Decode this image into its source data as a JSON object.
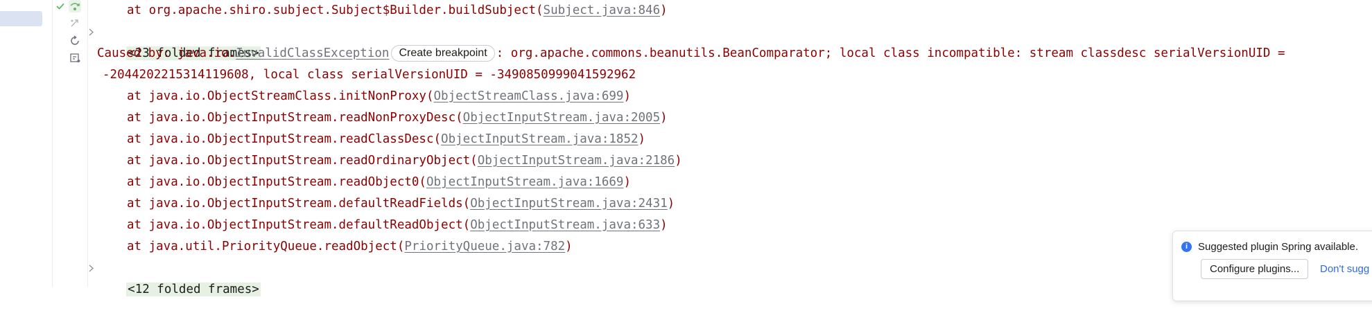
{
  "gutter": {
    "icons": [
      "check-icon",
      "step-over-icon",
      "step-disabled-icon",
      "restore-layout-icon",
      "export-icon"
    ]
  },
  "console": {
    "line0": {
      "prefix": "at org.apache.shiro.subject.Subject$Builder.buildSubject(",
      "ref": "Subject.java:846",
      "suffix": ")"
    },
    "folded1": "<23 folded frames>",
    "caused": {
      "prefix": "Caused by: java.io.",
      "exception": "InvalidClassException",
      "breakpoint_label": "Create breakpoint",
      "message": ": org.apache.commons.beanutils.BeanComparator; local class incompatible: stream classdesc serialVersionUID =",
      "message2": "-2044202215314119608, local class serialVersionUID = -3490850999041592962"
    },
    "frames": [
      {
        "prefix": "at java.io.ObjectStreamClass.initNonProxy(",
        "ref": "ObjectStreamClass.java:699",
        "suffix": ")"
      },
      {
        "prefix": "at java.io.ObjectInputStream.readNonProxyDesc(",
        "ref": "ObjectInputStream.java:2005",
        "suffix": ")"
      },
      {
        "prefix": "at java.io.ObjectInputStream.readClassDesc(",
        "ref": "ObjectInputStream.java:1852",
        "suffix": ")"
      },
      {
        "prefix": "at java.io.ObjectInputStream.readOrdinaryObject(",
        "ref": "ObjectInputStream.java:2186",
        "suffix": ")"
      },
      {
        "prefix": "at java.io.ObjectInputStream.readObject0(",
        "ref": "ObjectInputStream.java:1669",
        "suffix": ")"
      },
      {
        "prefix": "at java.io.ObjectInputStream.defaultReadFields(",
        "ref": "ObjectInputStream.java:2431",
        "suffix": ")"
      },
      {
        "prefix": "at java.io.ObjectInputStream.defaultReadObject(",
        "ref": "ObjectInputStream.java:633",
        "suffix": ")"
      },
      {
        "prefix": "at java.util.PriorityQueue.readObject(",
        "ref": "PriorityQueue.java:782",
        "suffix": ")"
      }
    ],
    "folded2": "<12 folded frames>"
  },
  "notification": {
    "message": "Suggested plugin Spring available.",
    "configure_label": "Configure plugins...",
    "dismiss_label": "Don't sugg"
  },
  "colors": {
    "error_text": "#8b0000",
    "link_ref": "#6f737a",
    "folded_bg": "#e6f1e4",
    "accent": "#3574f0"
  }
}
